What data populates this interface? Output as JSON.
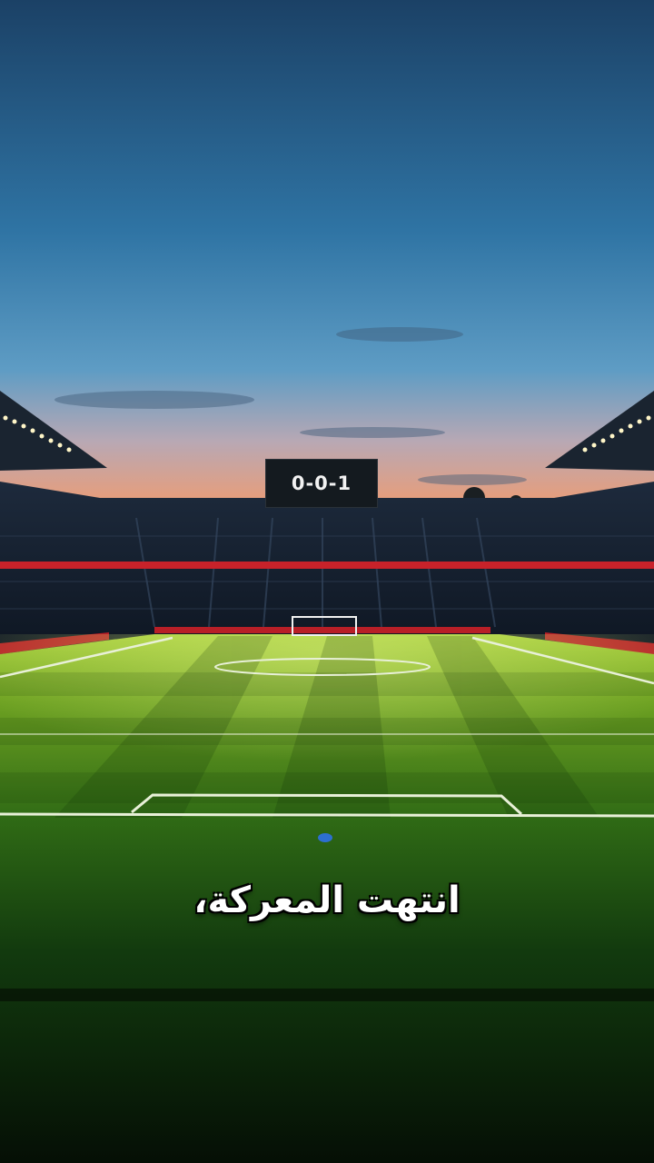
{
  "scoreboard": {
    "score": "0-0-1"
  },
  "caption": {
    "text": "انتهت المعركة،"
  },
  "colors": {
    "sky_top": "#1c4a6e",
    "sky_mid": "#3f84b3",
    "sky_horizon": "#f0a27a",
    "pitch_light": "#8fbf2a",
    "pitch_dark": "#0c2a0a",
    "ad_boards": "#c8222a"
  }
}
